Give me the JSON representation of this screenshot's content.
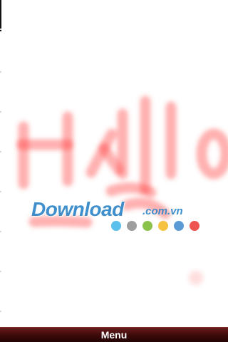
{
  "canvas": {
    "stroke_color": "#ff3b3b",
    "handwriting_description": "Hello (Korean-like strokes)"
  },
  "watermark": {
    "word": "Download",
    "domain": ".com.vn",
    "text_color": "#2f86c8",
    "dot_colors": [
      "#5bc0eb",
      "#9e9e9e",
      "#8bc34a",
      "#f5c242",
      "#5b9bd5",
      "#ef5350"
    ]
  },
  "menubar": {
    "label": "Menu",
    "background_color": "#3b0909"
  }
}
